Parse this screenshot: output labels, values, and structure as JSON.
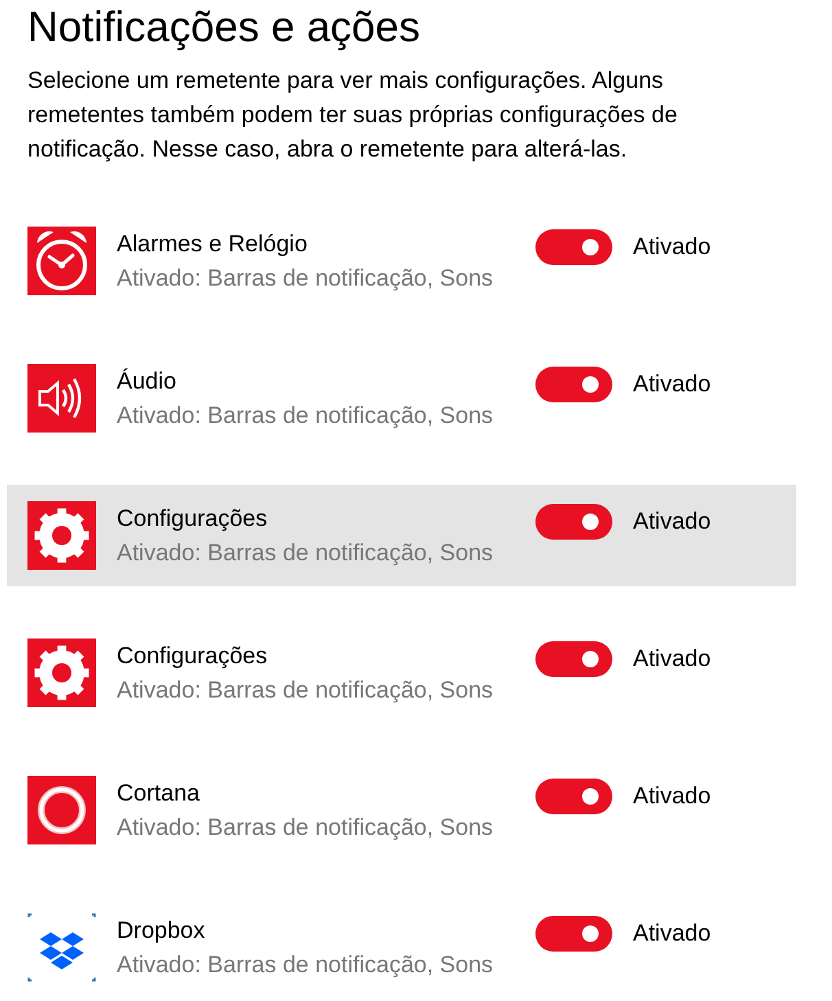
{
  "title": "Notificações e ações",
  "description": "Selecione um remetente para ver mais configurações. Alguns remetentes também podem ter suas próprias configurações de notificação. Nesse caso, abra o remetente para alterá-las.",
  "senders": [
    {
      "kind": "alarm",
      "name": "Alarmes e Relógio",
      "detail": "Ativado: Barras de notificação, Sons",
      "on": true,
      "state_label": "Ativado",
      "selected": false
    },
    {
      "kind": "audio",
      "name": "Áudio",
      "detail": "Ativado: Barras de notificação, Sons",
      "on": true,
      "state_label": "Ativado",
      "selected": false
    },
    {
      "kind": "gear",
      "name": "Configurações",
      "detail": "Ativado: Barras de notificação, Sons",
      "on": true,
      "state_label": "Ativado",
      "selected": true
    },
    {
      "kind": "gear",
      "name": "Configurações",
      "detail": "Ativado: Barras de notificação, Sons",
      "on": true,
      "state_label": "Ativado",
      "selected": false
    },
    {
      "kind": "ring",
      "name": "Cortana",
      "detail": "Ativado: Barras de notificação, Sons",
      "on": true,
      "state_label": "Ativado",
      "selected": false
    },
    {
      "kind": "dropbox",
      "name": "Dropbox",
      "detail": "Ativado: Barras de notificação, Sons",
      "on": true,
      "state_label": "Ativado",
      "selected": false
    }
  ]
}
